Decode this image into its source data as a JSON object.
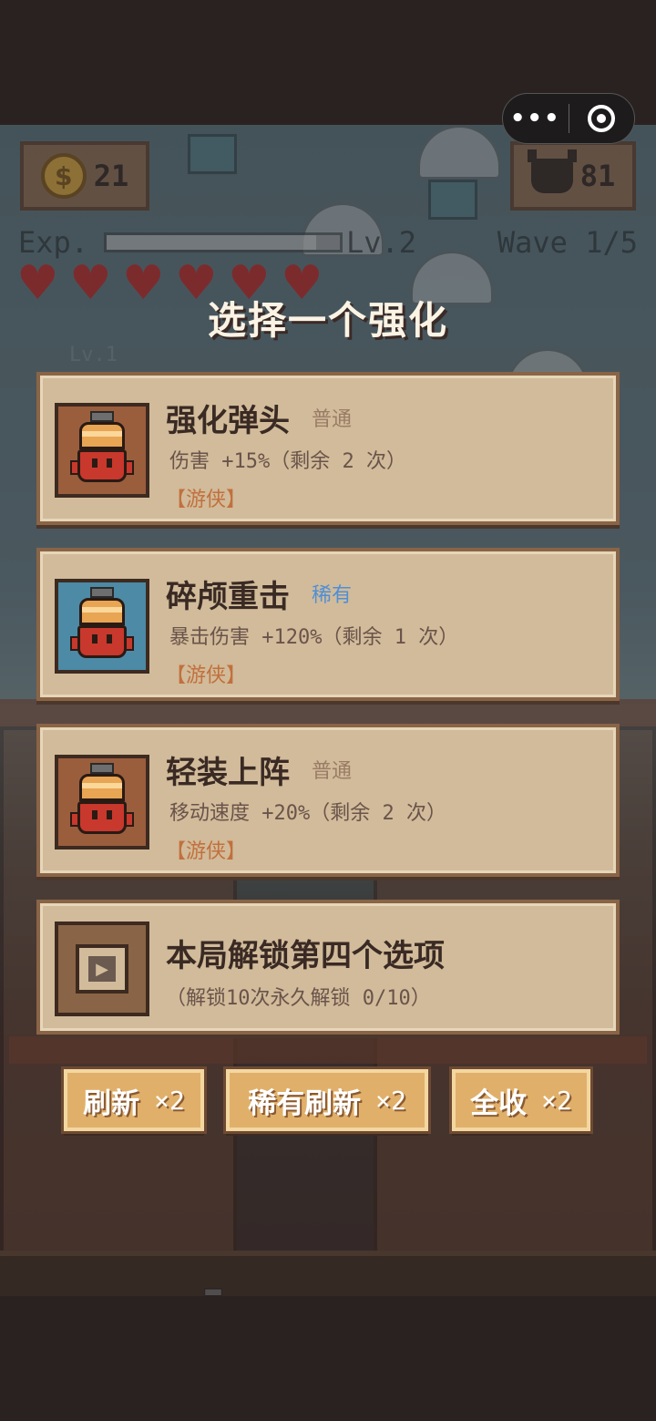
{
  "miniprogram": {
    "more_glyph": "•••"
  },
  "hud": {
    "coins": "21",
    "coin_symbol": "$",
    "enemies_left": "81",
    "exp_label": "Exp.",
    "exp_fraction": 0.9,
    "level": "Lv.2",
    "wave": "Wave 1/5",
    "hearts": 6,
    "minion_level": "Lv.1"
  },
  "dialog": {
    "title": "选择一个强化",
    "options": [
      {
        "name": "强化弹头",
        "rarity": "普通",
        "rarity_type": "common",
        "desc": "伤害 +15%（剩余 2 次）",
        "tag": "【游侠】"
      },
      {
        "name": "碎颅重击",
        "rarity": "稀有",
        "rarity_type": "rare",
        "desc": "暴击伤害 +120%（剩余 1 次）",
        "tag": "【游侠】"
      },
      {
        "name": "轻装上阵",
        "rarity": "普通",
        "rarity_type": "common",
        "desc": "移动速度 +20%（剩余 2 次）",
        "tag": "【游侠】"
      }
    ],
    "unlock": {
      "name": "本局解锁第四个选项",
      "desc": "（解锁10次永久解锁 0/10）"
    },
    "actions": [
      {
        "label": "刷新",
        "count": "×2"
      },
      {
        "label": "稀有刷新",
        "count": "×2"
      },
      {
        "label": "全收",
        "count": "×2"
      }
    ]
  },
  "player": {
    "box_glyph": "?"
  },
  "colors": {
    "card_bg": "#d1bb9a",
    "card_border": "#8a6446",
    "rare_blue": "#4f8fd6",
    "tag_orange": "#c2703d",
    "button_bg": "#e0b06b"
  }
}
